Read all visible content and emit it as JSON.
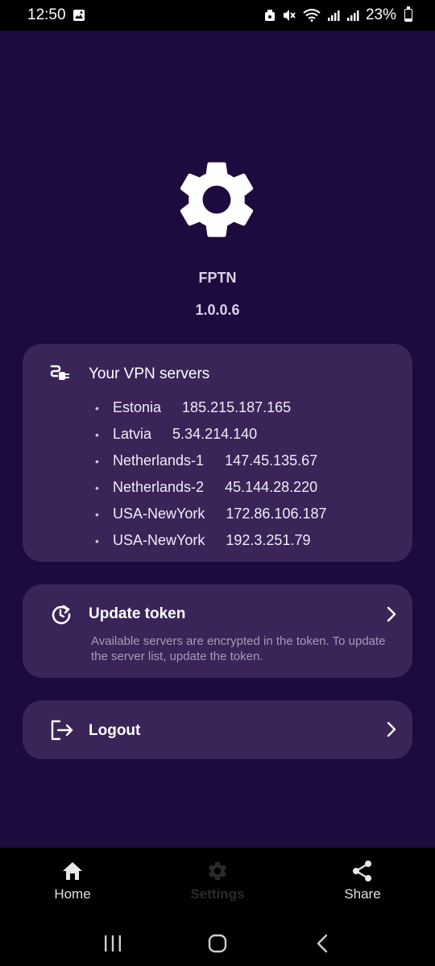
{
  "status_bar": {
    "time": "12:50",
    "battery": "23%"
  },
  "app": {
    "name": "FPTN",
    "version": "1.0.0.6",
    "logo_icon": "gear-icon",
    "colors": {
      "background": "#1d0a3e",
      "card": "#3a2458",
      "nav_background": "#000000"
    }
  },
  "servers_card": {
    "title": "Your VPN servers",
    "icon": "plug-icon",
    "servers": [
      {
        "name": "Estonia",
        "ip": "185.215.187.165"
      },
      {
        "name": "Latvia",
        "ip": "5.34.214.140"
      },
      {
        "name": "Netherlands-1",
        "ip": "147.45.135.67"
      },
      {
        "name": "Netherlands-2",
        "ip": "45.144.28.220"
      },
      {
        "name": "USA-NewYork",
        "ip": "172.86.106.187"
      },
      {
        "name": "USA-NewYork",
        "ip": "192.3.251.79"
      }
    ]
  },
  "token_card": {
    "title": "Update token",
    "icon": "refresh-clock-icon",
    "description": "Available servers are encrypted in the token. To update the server list, update the token."
  },
  "logout_card": {
    "title": "Logout",
    "icon": "logout-icon"
  },
  "bottom_nav": {
    "items": [
      {
        "label": "Home",
        "icon": "home-icon"
      },
      {
        "label": "Settings",
        "icon": "gear-icon",
        "active": true
      },
      {
        "label": "Share",
        "icon": "share-icon"
      }
    ]
  },
  "system_nav": {
    "buttons": [
      "recent-apps-icon",
      "home-circle-icon",
      "back-icon"
    ]
  }
}
